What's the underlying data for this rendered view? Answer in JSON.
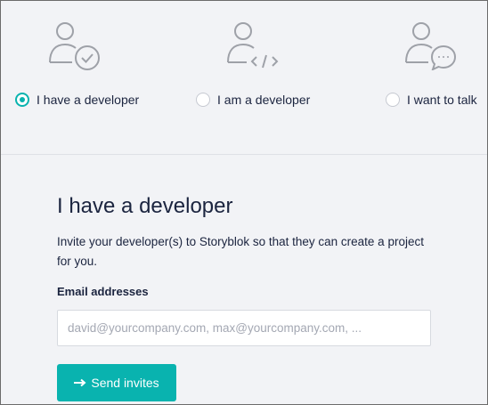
{
  "options": [
    {
      "label": "I have a developer",
      "icon": "user-check-icon",
      "selected": true
    },
    {
      "label": "I am a developer",
      "icon": "user-code-icon",
      "selected": false
    },
    {
      "label": "I want to talk",
      "icon": "user-chat-icon",
      "selected": false
    }
  ],
  "main": {
    "title": "I have a developer",
    "description": "Invite your developer(s) to Storyblok so that they can create a project for you.",
    "email_label": "Email addresses",
    "email_value": "",
    "email_placeholder": "david@yourcompany.com, max@yourcompany.com, ...",
    "send_label": "Send invites"
  },
  "colors": {
    "accent": "#09b3af",
    "background": "#f2f3f6",
    "text": "#1b243f",
    "icon": "#9ea1a8"
  }
}
